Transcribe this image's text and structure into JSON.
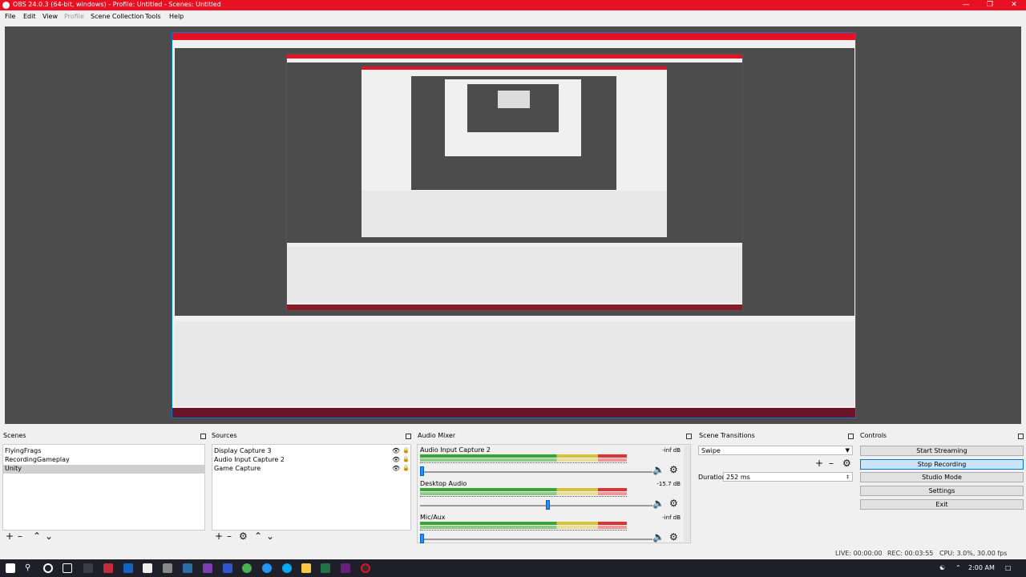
{
  "window": {
    "title": "OBS 24.0.3 (64-bit, windows) - Profile: Untitled - Scenes: Untitled"
  },
  "menu": [
    "File",
    "Edit",
    "View",
    "Profile",
    "Scene Collection",
    "Tools",
    "Help"
  ],
  "panels": {
    "scenes": {
      "title": "Scenes",
      "items": [
        "FlyingFrags",
        "RecordingGameplay",
        "Unity"
      ],
      "selected": "Unity"
    },
    "sources": {
      "title": "Sources",
      "items": [
        "Display Capture 3",
        "Audio Input Capture 2",
        "Game Capture"
      ]
    },
    "mixer": {
      "title": "Audio Mixer",
      "channels": [
        {
          "name": "Audio Input Capture 2",
          "db": "-inf dB",
          "level": 0
        },
        {
          "name": "Desktop Audio",
          "db": "-15.7 dB",
          "level": 0.6
        },
        {
          "name": "Mic/Aux",
          "db": "-inf dB",
          "level": 0
        }
      ]
    },
    "transitions": {
      "title": "Scene Transitions",
      "selected": "Swipe",
      "duration_label": "Duration",
      "duration_value": "252 ms"
    },
    "controls": {
      "title": "Controls",
      "buttons": [
        "Start Streaming",
        "Stop Recording",
        "Studio Mode",
        "Settings",
        "Exit"
      ],
      "active": "Stop Recording"
    }
  },
  "status": {
    "live": "LIVE: 00:00:00",
    "rec": "REC: 00:03:55",
    "cpu": "CPU: 3.0%, 30.00 fps"
  },
  "taskbar": {
    "time": "2:00 AM"
  },
  "colors": {
    "titlebar": "#e81123",
    "preview_bg": "#4c4c4c",
    "accent": "#0078d7",
    "taskbar": "#1f1f2a"
  }
}
